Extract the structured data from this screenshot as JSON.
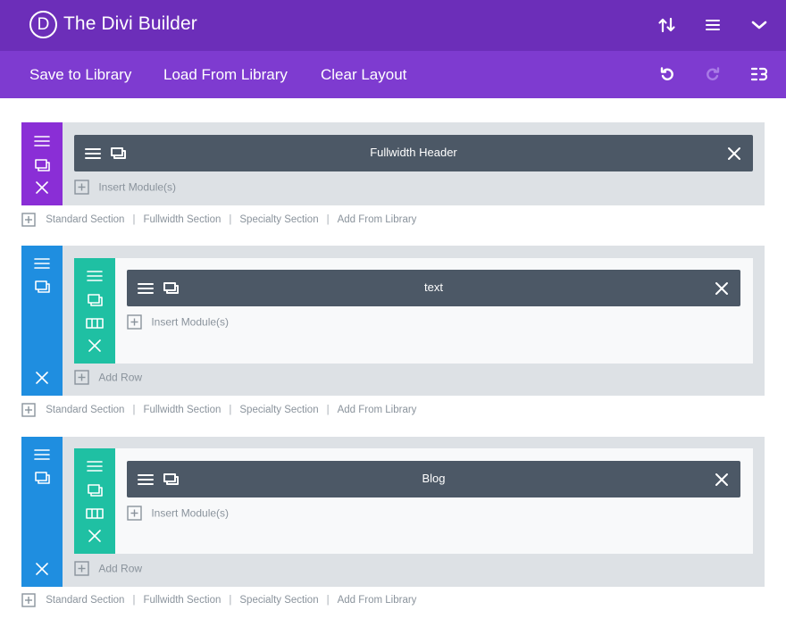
{
  "header": {
    "logo_letter": "D",
    "title": "The Divi Builder",
    "icons": [
      "transfer-arrows-icon",
      "menu-icon",
      "chevron-down-icon"
    ]
  },
  "toolbar": {
    "save_label": "Save to Library",
    "load_label": "Load From Library",
    "clear_label": "Clear Layout",
    "icons": [
      "undo-icon",
      "redo-icon",
      "history-icon"
    ]
  },
  "sections": [
    {
      "type": "fullwidth",
      "color": "#8a2ed6",
      "module": "Fullwidth Header",
      "insert_label": "Insert Module(s)"
    },
    {
      "type": "regular",
      "color": "#1f8ee0",
      "row_color": "#1fc0a3",
      "module": "text",
      "insert_label": "Insert Module(s)",
      "add_row_label": "Add Row"
    },
    {
      "type": "regular",
      "color": "#1f8ee0",
      "row_color": "#1fc0a3",
      "module": "Blog",
      "insert_label": "Insert Module(s)",
      "add_row_label": "Add Row"
    }
  ],
  "section_links": [
    "Standard Section",
    "Fullwidth Section",
    "Specialty Section",
    "Add From Library"
  ]
}
